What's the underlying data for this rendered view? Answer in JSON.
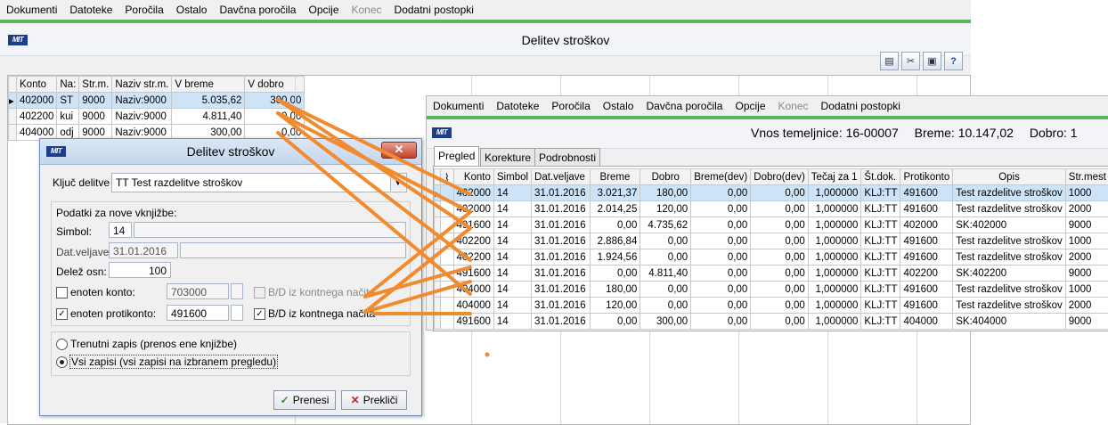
{
  "menu": [
    "Dokumenti",
    "Datoteke",
    "Poročila",
    "Ostalo",
    "Davčna poročila",
    "Opcije",
    "Konec",
    "Dodatni postopki"
  ],
  "menu_disabled": "Konec",
  "logo_text": "MIT",
  "main": {
    "title": "Delitev stroškov",
    "toolbar_icons": [
      "document-icon",
      "scissors-icon",
      "monitor-icon",
      "help-icon"
    ],
    "grid": {
      "headers": [
        "Konto",
        "Na:",
        "Str.m.",
        "Naziv str.m.",
        "V breme",
        "V dobro"
      ],
      "rows": [
        [
          "402000",
          "ST",
          "9000",
          "Naziv:9000",
          "5.035,62",
          "300,00"
        ],
        [
          "402200",
          "kui",
          "9000",
          "Naziv:9000",
          "4.811,40",
          "0,00"
        ],
        [
          "404000",
          "odj",
          "9000",
          "Naziv:9000",
          "300,00",
          "0,00"
        ]
      ]
    }
  },
  "dialog": {
    "title": "Delitev stroškov",
    "close_label": "✕",
    "kljuc_label": "Ključ delitve",
    "kljuc_value": "TT  Test razdelitve stroškov",
    "group_label": "Podatki za nove vknjižbe:",
    "simbol_label": "Simbol:",
    "simbol_value": "14",
    "datum_label": "Dat.veljave:",
    "datum_value": "31.01.2016",
    "delez_label": "Delež osn:",
    "delez_value": "100",
    "enoten_konto_label": "enoten konto:",
    "enoten_konto_value": "703000",
    "bd1_label": "B/D iz kontnega načita",
    "enoten_protikonto_label": "enoten protikonto:",
    "enoten_protikonto_value": "491600",
    "bd2_label": "B/D iz kontnega načita",
    "radio1_label": "Trenutni zapis (prenos ene knjižbe)",
    "radio2_label": "Vsi zapisi (vsi zapisi na izbranem pregledu)",
    "ok_label": "Prenesi",
    "cancel_label": "Prekliči"
  },
  "front": {
    "header": {
      "vnos_label": "Vnos temeljnice:",
      "vnos_value": "16-00007",
      "breme_label": "Breme:",
      "breme_value": "10.147,02",
      "dobro_label": "Dobro:",
      "dobro_value": "1"
    },
    "tabs": [
      "Pregled",
      "Korekture",
      "Podrobnosti"
    ],
    "grid": {
      "headers": [
        "Konto",
        "Simbol",
        "Dat.veljave",
        "Breme",
        "Dobro",
        "Breme(dev)",
        "Dobro(dev)",
        "Tečaj za 1",
        "Št.dok.",
        "Protikonto",
        "Opis",
        "Str.mest"
      ],
      "rows": [
        [
          "402000",
          "14",
          "31.01.2016",
          "3.021,37",
          "180,00",
          "0,00",
          "0,00",
          "1,000000",
          "KLJ:TT",
          "491600",
          "Test razdelitve stroškov",
          "1000"
        ],
        [
          "402000",
          "14",
          "31.01.2016",
          "2.014,25",
          "120,00",
          "0,00",
          "0,00",
          "1,000000",
          "KLJ:TT",
          "491600",
          "Test razdelitve stroškov",
          "2000"
        ],
        [
          "491600",
          "14",
          "31.01.2016",
          "0,00",
          "4.735,62",
          "0,00",
          "0,00",
          "1,000000",
          "KLJ:TT",
          "402000",
          "SK:402000",
          "9000"
        ],
        [
          "402200",
          "14",
          "31.01.2016",
          "2.886,84",
          "0,00",
          "0,00",
          "0,00",
          "1,000000",
          "KLJ:TT",
          "491600",
          "Test razdelitve stroškov",
          "1000"
        ],
        [
          "402200",
          "14",
          "31.01.2016",
          "1.924,56",
          "0,00",
          "0,00",
          "0,00",
          "1,000000",
          "KLJ:TT",
          "491600",
          "Test razdelitve stroškov",
          "2000"
        ],
        [
          "491600",
          "14",
          "31.01.2016",
          "0,00",
          "4.811,40",
          "0,00",
          "0,00",
          "1,000000",
          "KLJ:TT",
          "402200",
          "SK:402200",
          "9000"
        ],
        [
          "404000",
          "14",
          "31.01.2016",
          "180,00",
          "0,00",
          "0,00",
          "0,00",
          "1,000000",
          "KLJ:TT",
          "491600",
          "Test razdelitve stroškov",
          "1000"
        ],
        [
          "404000",
          "14",
          "31.01.2016",
          "120,00",
          "0,00",
          "0,00",
          "0,00",
          "1,000000",
          "KLJ:TT",
          "491600",
          "Test razdelitve stroškov",
          "2000"
        ],
        [
          "491600",
          "14",
          "31.01.2016",
          "0,00",
          "300,00",
          "0,00",
          "0,00",
          "1,000000",
          "KLJ:TT",
          "404000",
          "SK:404000",
          "9000"
        ]
      ]
    }
  },
  "annotation_color": "#f28a2e"
}
